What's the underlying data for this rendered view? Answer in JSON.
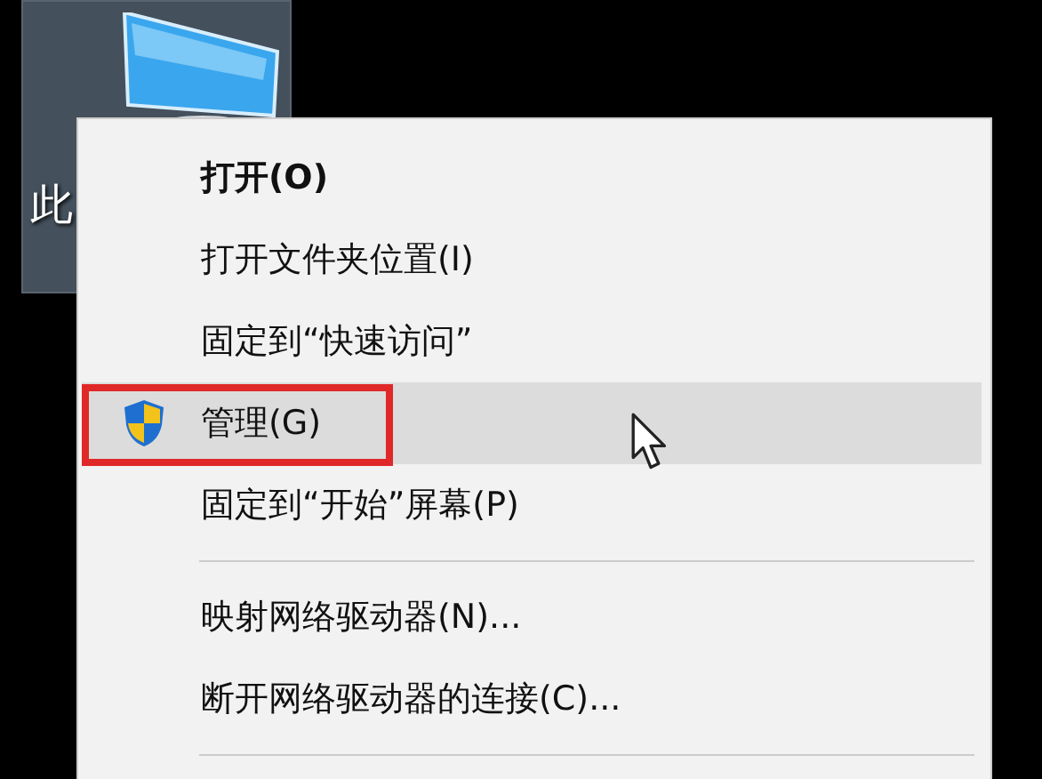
{
  "desktop_icon": {
    "label": "此",
    "selected": true
  },
  "context_menu": {
    "items": [
      {
        "kind": "item",
        "label": "打开(O)",
        "default": true,
        "has_icon": false,
        "selected": false,
        "annotated": false
      },
      {
        "kind": "item",
        "label": "打开文件夹位置(I)",
        "default": false,
        "has_icon": false,
        "selected": false,
        "annotated": false
      },
      {
        "kind": "item",
        "label": "固定到“快速访问”",
        "default": false,
        "has_icon": false,
        "selected": false,
        "annotated": false
      },
      {
        "kind": "item",
        "label": "管理(G)",
        "default": false,
        "has_icon": true,
        "selected": true,
        "annotated": true
      },
      {
        "kind": "item",
        "label": "固定到“开始”屏幕(P)",
        "default": false,
        "has_icon": false,
        "selected": false,
        "annotated": false
      },
      {
        "kind": "separator"
      },
      {
        "kind": "item",
        "label": "映射网络驱动器(N)...",
        "default": false,
        "has_icon": false,
        "selected": false,
        "annotated": false
      },
      {
        "kind": "item",
        "label": "断开网络驱动器的连接(C)...",
        "default": false,
        "has_icon": false,
        "selected": false,
        "annotated": false
      },
      {
        "kind": "separator"
      }
    ]
  }
}
